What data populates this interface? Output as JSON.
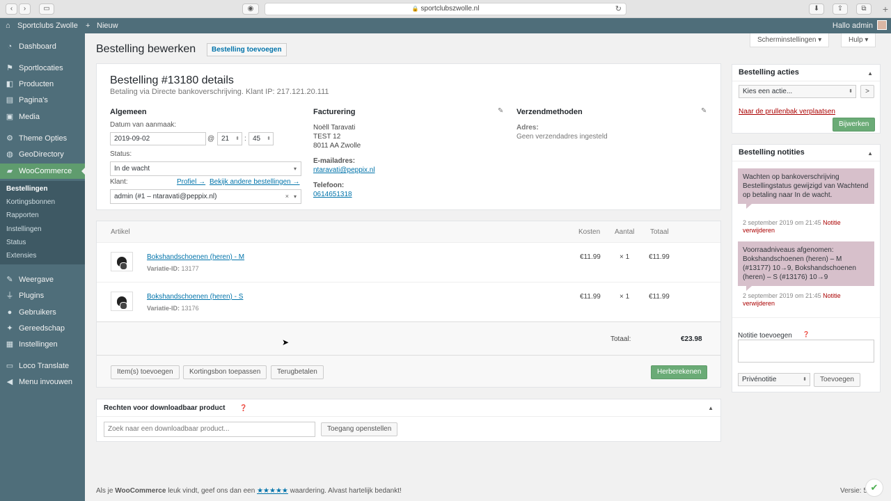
{
  "browser": {
    "url": "sportclubszwolle.nl"
  },
  "adminbar": {
    "site": "Sportclubs Zwolle",
    "new": "Nieuw",
    "greeting": "Hallo admin"
  },
  "sidebar": {
    "items": [
      {
        "label": "Dashboard",
        "icon": "dashboard-icon"
      },
      {
        "label": "Sportlocaties",
        "icon": "pin-icon"
      },
      {
        "label": "Producten",
        "icon": "box-icon"
      },
      {
        "label": "Pagina's",
        "icon": "page-icon"
      },
      {
        "label": "Media",
        "icon": "media-icon"
      },
      {
        "label": "Theme Opties",
        "icon": "gear-icon"
      },
      {
        "label": "GeoDirectory",
        "icon": "globe-icon"
      },
      {
        "label": "WooCommerce",
        "icon": "woo-icon"
      },
      {
        "label": "Weergave",
        "icon": "brush-icon"
      },
      {
        "label": "Plugins",
        "icon": "plug-icon"
      },
      {
        "label": "Gebruikers",
        "icon": "user-icon"
      },
      {
        "label": "Gereedschap",
        "icon": "wrench-icon"
      },
      {
        "label": "Instellingen",
        "icon": "settings-icon"
      },
      {
        "label": "Loco Translate",
        "icon": "translate-icon"
      },
      {
        "label": "Menu invouwen",
        "icon": "collapse-icon"
      }
    ],
    "submenu": [
      "Bestellingen",
      "Kortingsbonnen",
      "Rapporten",
      "Instellingen",
      "Status",
      "Extensies"
    ]
  },
  "header": {
    "title": "Bestelling bewerken",
    "add_order": "Bestelling toevoegen",
    "screen_options": "Scherminstellingen",
    "help": "Hulp"
  },
  "order": {
    "title": "Bestelling #13180 details",
    "subtitle": "Betaling via Directe bankoverschrijving. Klant IP: 217.121.20.111",
    "general": {
      "heading": "Algemeen",
      "date_label": "Datum van aanmaak:",
      "date": "2019-09-02",
      "at": "@",
      "hour": "21",
      "colon": ":",
      "minute": "45",
      "status_label": "Status:",
      "status": "In de wacht",
      "customer_label": "Klant:",
      "profile_link": "Profiel →",
      "other_orders_link": "Bekijk andere bestellingen →",
      "customer": "admin (#1 – ntaravati@peppix.nl)"
    },
    "billing": {
      "heading": "Facturering",
      "name": "Noëll Taravati",
      "line1": "TEST 12",
      "line2": "8011 AA Zwolle",
      "email_label": "E-mailadres:",
      "email": "ntaravati@peppix.nl",
      "phone_label": "Telefoon:",
      "phone": "0614651318"
    },
    "shipping": {
      "heading": "Verzendmethoden",
      "address_label": "Adres:",
      "address": "Geen verzendadres ingesteld"
    }
  },
  "items": {
    "headers": {
      "article": "Artikel",
      "cost": "Kosten",
      "qty": "Aantal",
      "total": "Totaal"
    },
    "rows": [
      {
        "name": "Bokshandschoenen (heren) - M",
        "variation_label": "Variatie-ID:",
        "variation": "13177",
        "cost": "€11.99",
        "qty": "× 1",
        "total": "€11.99"
      },
      {
        "name": "Bokshandschoenen (heren) - S",
        "variation_label": "Variatie-ID:",
        "variation": "13176",
        "cost": "€11.99",
        "qty": "× 1",
        "total": "€11.99"
      }
    ],
    "total_label": "Totaal:",
    "total": "€23.98",
    "buttons": {
      "add_items": "Item(s) toevoegen",
      "coupon": "Kortingsbon toepassen",
      "refund": "Terugbetalen",
      "recalc": "Herberekenen"
    }
  },
  "downloads": {
    "title": "Rechten voor downloadbaar product",
    "search_placeholder": "Zoek naar een downloadbaar product...",
    "grant": "Toegang openstellen"
  },
  "actions": {
    "title": "Bestelling acties",
    "select": "Kies een actie...",
    "go": ">",
    "trash": "Naar de prullenbak verplaatsen",
    "update": "Bijwerken"
  },
  "notes": {
    "title": "Bestelling notities",
    "list": [
      {
        "text": "Wachten op bankoverschrijving Bestellingstatus gewijzigd van Wachtend op betaling naar In de wacht.",
        "meta": "2 september 2019 om 21:45",
        "delete": "Notitie verwijderen"
      },
      {
        "text": "Voorraadniveaus afgenomen: Bokshandschoenen (heren) – M (#13177) 10→9, Bokshandschoenen (heren) – S (#13176) 10→9",
        "meta": "2 september 2019 om 21:45",
        "delete": "Notitie verwijderen"
      }
    ],
    "add_label": "Notitie toevoegen",
    "type": "Privénotitie",
    "add_button": "Toevoegen"
  },
  "footer": {
    "pre": "Als je",
    "brand": "WooCommerce",
    "mid": "leuk vindt, geef ons dan een",
    "stars": "★★★★★",
    "post": "waardering. Alvast hartelijk bedankt!",
    "version": "Versie: 5"
  }
}
